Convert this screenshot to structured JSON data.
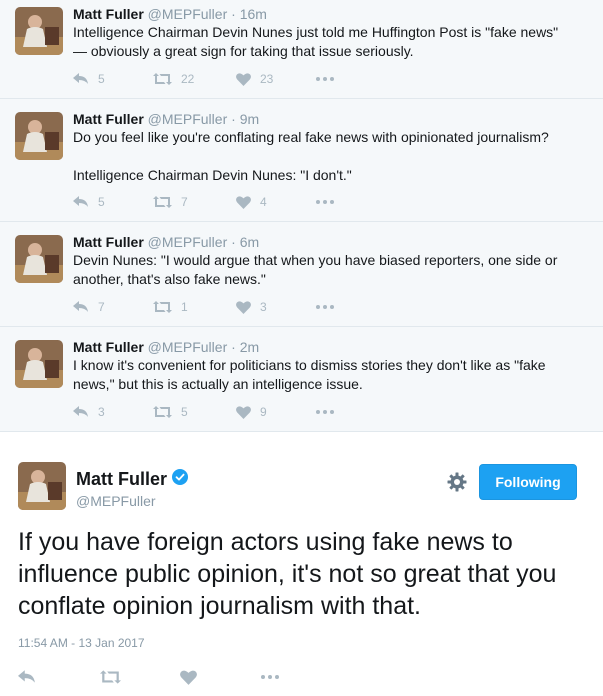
{
  "thread": [
    {
      "name": "Matt Fuller",
      "handle": "@MEPFuller",
      "separator": "·",
      "time": "16m",
      "text": [
        "Intelligence Chairman Devin Nunes just told me Huffington Post is \"fake news\"",
        "— obviously a great sign for taking that issue seriously."
      ],
      "reply_count": "5",
      "retweet_count": "22",
      "like_count": "23"
    },
    {
      "name": "Matt Fuller",
      "handle": "@MEPFuller",
      "separator": "·",
      "time": "9m",
      "text": [
        "Do you feel like you're conflating real fake news with opinionated journalism?",
        "Intelligence Chairman Devin Nunes: \"I don't.\""
      ],
      "reply_count": "5",
      "retweet_count": "7",
      "like_count": "4"
    },
    {
      "name": "Matt Fuller",
      "handle": "@MEPFuller",
      "separator": "·",
      "time": "6m",
      "text": [
        "Devin Nunes: \"I would argue that when you have biased reporters, one side or",
        "another, that's also fake news.\""
      ],
      "reply_count": "7",
      "retweet_count": "1",
      "like_count": "3"
    },
    {
      "name": "Matt Fuller",
      "handle": "@MEPFuller",
      "separator": "·",
      "time": "2m",
      "text": [
        "I know it's convenient for politicians to dismiss stories they don't like as \"fake",
        "news,\" but this is actually an intelligence issue."
      ],
      "reply_count": "3",
      "retweet_count": "5",
      "like_count": "9"
    }
  ],
  "main_tweet": {
    "name": "Matt Fuller",
    "handle": "@MEPFuller",
    "follow_label": "Following",
    "text": "If you have foreign actors using fake news to influence public opinion, it's not so great that you conflate opinion journalism with that.",
    "timestamp": "11:54 AM - 13 Jan 2017"
  },
  "colors": {
    "thread_bg": "#f5f8fa",
    "accent": "#1da1f2",
    "muted": "#8899a6",
    "icon": "#aab8c2"
  },
  "icons": [
    "reply-icon",
    "retweet-icon",
    "like-icon",
    "more-icon",
    "gear-icon",
    "verified-icon"
  ]
}
